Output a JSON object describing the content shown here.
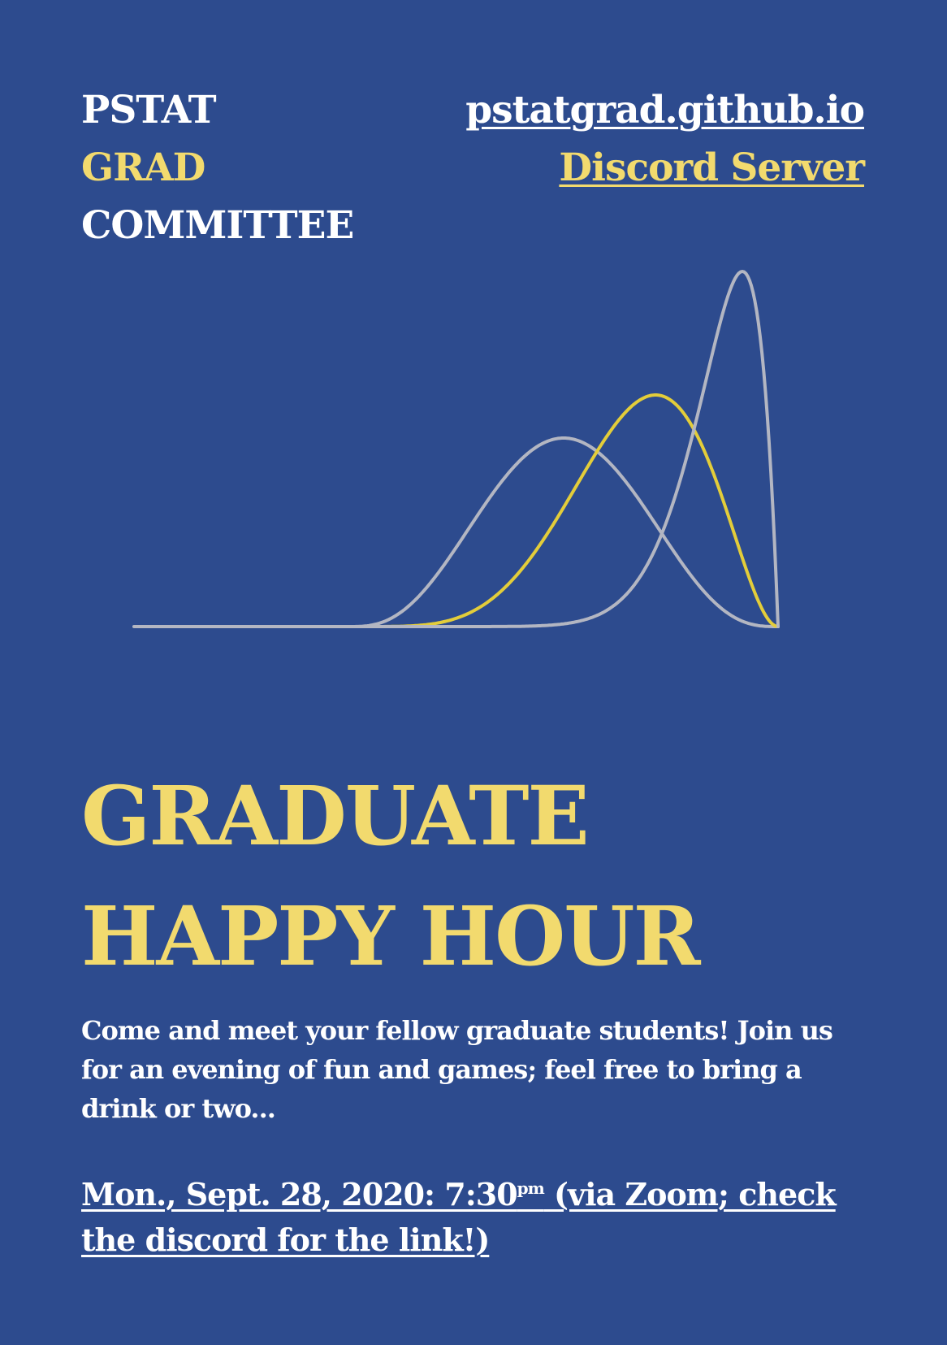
{
  "organization": {
    "line1": "PSTAT",
    "line2": "GRAD",
    "line3": "COMMITTEE"
  },
  "links": {
    "website": "pstatgrad.github.io",
    "discord": "Discord Server"
  },
  "headline": {
    "line1": "GRADUATE",
    "line2": "HAPPY HOUR"
  },
  "blurb": "Come and meet your fellow graduate students! Join us for an evening of fun and games; feel free to bring a drink or two...",
  "event": {
    "date_time": "Mon., Sept. 28, 2020: 7:30",
    "time_suffix": "pm",
    "details": " (via Zoom; check the discord for the link!)"
  },
  "colors": {
    "background": "#2d4b8e",
    "white": "#ffffff",
    "yellow": "#f2da6e",
    "curve_gray": "#b3b6c2",
    "curve_yellow": "#e3cd3a"
  }
}
